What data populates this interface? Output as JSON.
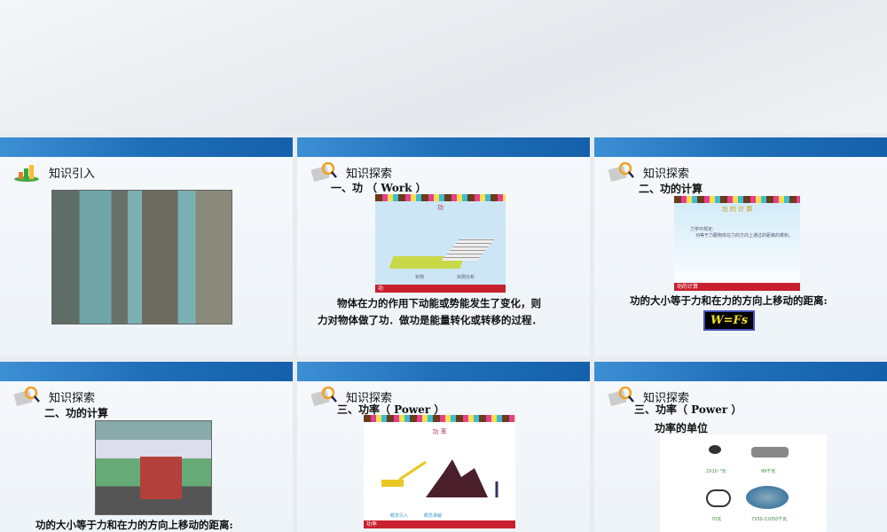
{
  "slides": [
    {
      "title": "知识引入"
    },
    {
      "title": "知识探索",
      "subtitle": "一、功 （ Work ）",
      "image_caption": "功",
      "image_labels": [
        "实例",
        "实例分析"
      ],
      "image_bar": "功",
      "text": [
        "物体在力的作用下动能或势能发生了变化，则",
        "力对物体做了功．做功是能量转化或转移的过程．"
      ]
    },
    {
      "title": "知识探索",
      "subtitle": "二、功的计算",
      "image_caption": "功 的 计 算",
      "image_text": [
        "力学中规定:",
        "功等于力跟物体在力的方向上通过的距离的乘积。"
      ],
      "image_bar": "功的计算",
      "text": "功的大小等于力和在力的方向上移动的距离:",
      "formula": "W=Fs"
    },
    {
      "title": "知识探索",
      "subtitle": "二、功的计算",
      "text": "功的大小等于力和在力的方向上移动的距离:"
    },
    {
      "title": "知识探索",
      "subtitle": "三、功率（ Power ）",
      "image_caption": "功 率",
      "image_labels": [
        "概念引入",
        "概念讲解"
      ],
      "image_bar": "功率"
    },
    {
      "title": "知识探索",
      "subtitle": "三、功率（ Power ）",
      "subtitle2": "功率的单位",
      "units": [
        "2X10⁻⁵瓦",
        "99千瓦",
        "70瓦",
        "7350-22050千瓦"
      ]
    }
  ]
}
